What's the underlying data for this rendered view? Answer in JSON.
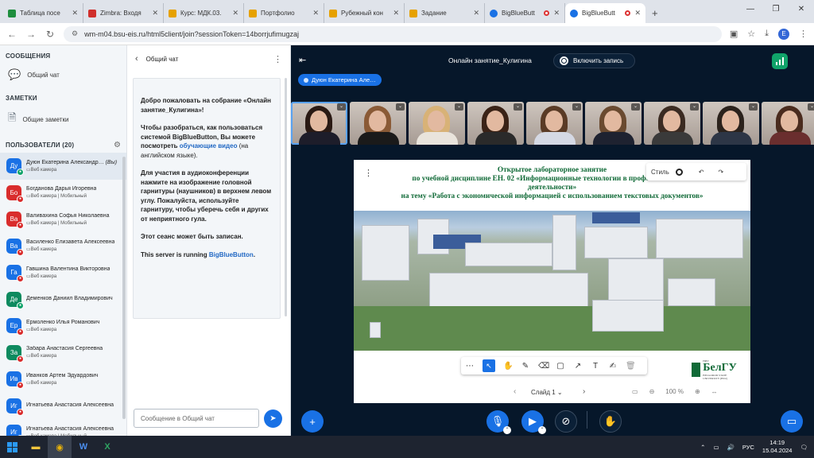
{
  "browser": {
    "tabs": [
      {
        "title": "Таблица посе",
        "color": "#1e8e3e",
        "active": false
      },
      {
        "title": "Zimbra: Входя",
        "color": "#d0302c",
        "active": false
      },
      {
        "title": "Курс: МДК.03.",
        "color": "#e6a100",
        "active": false
      },
      {
        "title": "Портфолио",
        "color": "#e6a100",
        "active": false
      },
      {
        "title": "Рубежный кон",
        "color": "#e6a100",
        "active": false
      },
      {
        "title": "Задание",
        "color": "#e6a100",
        "active": false
      },
      {
        "title": "BigBlueButt",
        "color": "#1971e5",
        "active": false
      },
      {
        "title": "BigBlueButt",
        "color": "#1971e5",
        "active": true
      }
    ],
    "url": "wm-m04.bsu-eis.ru/html5client/join?sessionToken=14borrjufimugzaj",
    "profile_initial": "E"
  },
  "sidebar": {
    "messages_title": "СООБЩЕНИЯ",
    "public_chat": "Общий чат",
    "notes_title": "ЗАМЕТКИ",
    "shared_notes": "Общие заметки",
    "users_title": "ПОЛЬЗОВАТЕЛИ (20)",
    "users": [
      {
        "initials": "Ду",
        "name": "Дуюн Екатерина Александр…",
        "you": "(Вы)",
        "sub": "▭Веб камера",
        "color": "#1971e5",
        "mic": "on",
        "self": true
      },
      {
        "initials": "Бо",
        "name": "Богданова Дарья Игоревна",
        "sub": "▭Веб камера | Мобильный",
        "color": "#d92c2c",
        "mic": "off"
      },
      {
        "initials": "Ва",
        "name": "Валивахина Софья Николаевна",
        "sub": "▭Веб камера | Мобильный",
        "color": "#d92c2c",
        "mic": "off"
      },
      {
        "initials": "Ва",
        "name": "Василенко Елизавета Алексеевна",
        "sub": "▭Веб камера",
        "color": "#1971e5",
        "mic": "off"
      },
      {
        "initials": "Га",
        "name": "Гавшина Валентина Викторовна",
        "sub": "▭Веб камера",
        "color": "#1971e5",
        "mic": "off"
      },
      {
        "initials": "Де",
        "name": "Деменков Даниил Владимирович",
        "sub": "",
        "color": "#0e8a5f",
        "mic": "on"
      },
      {
        "initials": "Ер",
        "name": "Ермоленко Илья Романович",
        "sub": "▭Веб камера",
        "color": "#1971e5",
        "mic": "off"
      },
      {
        "initials": "За",
        "name": "Забара Анастасия Сергеевна",
        "sub": "▭Веб камера",
        "color": "#0e8a5f",
        "mic": "off"
      },
      {
        "initials": "Ив",
        "name": "Иванков Артем Эдуардович",
        "sub": "▭Веб камера",
        "color": "#1971e5",
        "mic": "off"
      },
      {
        "initials": "Иг",
        "name": "Игнатьева Анастасия Алексеевна",
        "sub": "",
        "color": "#1971e5",
        "mic": "off"
      },
      {
        "initials": "Иг",
        "name": "Игнатьева Анастасия Алексеевна",
        "sub": "▭Веб камера | Мобильный",
        "color": "#1971e5",
        "mic": "off"
      }
    ]
  },
  "chat": {
    "title": "Общий чат",
    "welcome": {
      "p1_a": "Добро пожаловать на собрание «",
      "p1_b": "Онлайн занятие_Кулигина",
      "p1_c": "»!",
      "p2_a": "Чтобы разобраться, как пользоваться системой BigBlueButton, ",
      "p2_b": "Вы можете посмотреть ",
      "p2_link": "обучающие видео",
      "p2_c": " (на английском языке).",
      "p3_a": "Для участия в аудиоконференции нажмите на изображение головной гарнитуры (наушников) в верхнем левом углу. ",
      "p3_b": "Пожалуйста, используйте гарнитуру, чтобы уберечь себя и других от неприятного гула.",
      "p4": "Этот сеанс может быть записан.",
      "p5_a": "This server is running ",
      "p5_link": "BigBlueButton",
      "p5_b": "."
    },
    "input_placeholder": "Сообщение в Общий чат"
  },
  "meeting": {
    "title": "Онлайн занятие_Кулигина",
    "record_label": "Включить запись",
    "talker": "Дуюн Екатерина Але…",
    "colors": {
      "accent": "#1971e5",
      "bg": "#06172a",
      "ok": "#10a36a"
    }
  },
  "thumbs": [
    {
      "hair": "#2a1a14",
      "body": "#1d1d2a",
      "speaking": true
    },
    {
      "hair": "#8a5a36",
      "body": "#1a1a1a"
    },
    {
      "hair": "#d8b277",
      "body": "#e9e4dc"
    },
    {
      "hair": "#3a2216",
      "body": "#2a2a2a"
    },
    {
      "hair": "#5a3b26",
      "body": "#d5d9e4"
    },
    {
      "hair": "#6a4a30",
      "body": "#1e2230"
    },
    {
      "hair": "#3b2b22",
      "body": "#3a3a3a"
    },
    {
      "hair": "#2b221c",
      "body": "#2d3646"
    },
    {
      "hair": "#4a2b1e",
      "body": "#6a2e2e"
    }
  ],
  "slide": {
    "line1": "Открытое лабораторное занятие",
    "line2": "по учебной дисциплине ЕН. 02 «Информационные технологии в профессиональной",
    "line3": "деятельности»",
    "line4": "на тему «Работа с экономической информацией с использованием текстовых документов»",
    "style_label": "Стиль",
    "slide_label": "Слайд 1",
    "zoom": "100 %",
    "logo_text": "БелГУ",
    "logo_top": "НИУ",
    "logo_sub": "BELGOROD STATE UNIVERSITY (BSU)"
  },
  "taskbar": {
    "lang": "РУС",
    "time": "14:19",
    "date": "15.04.2024"
  }
}
